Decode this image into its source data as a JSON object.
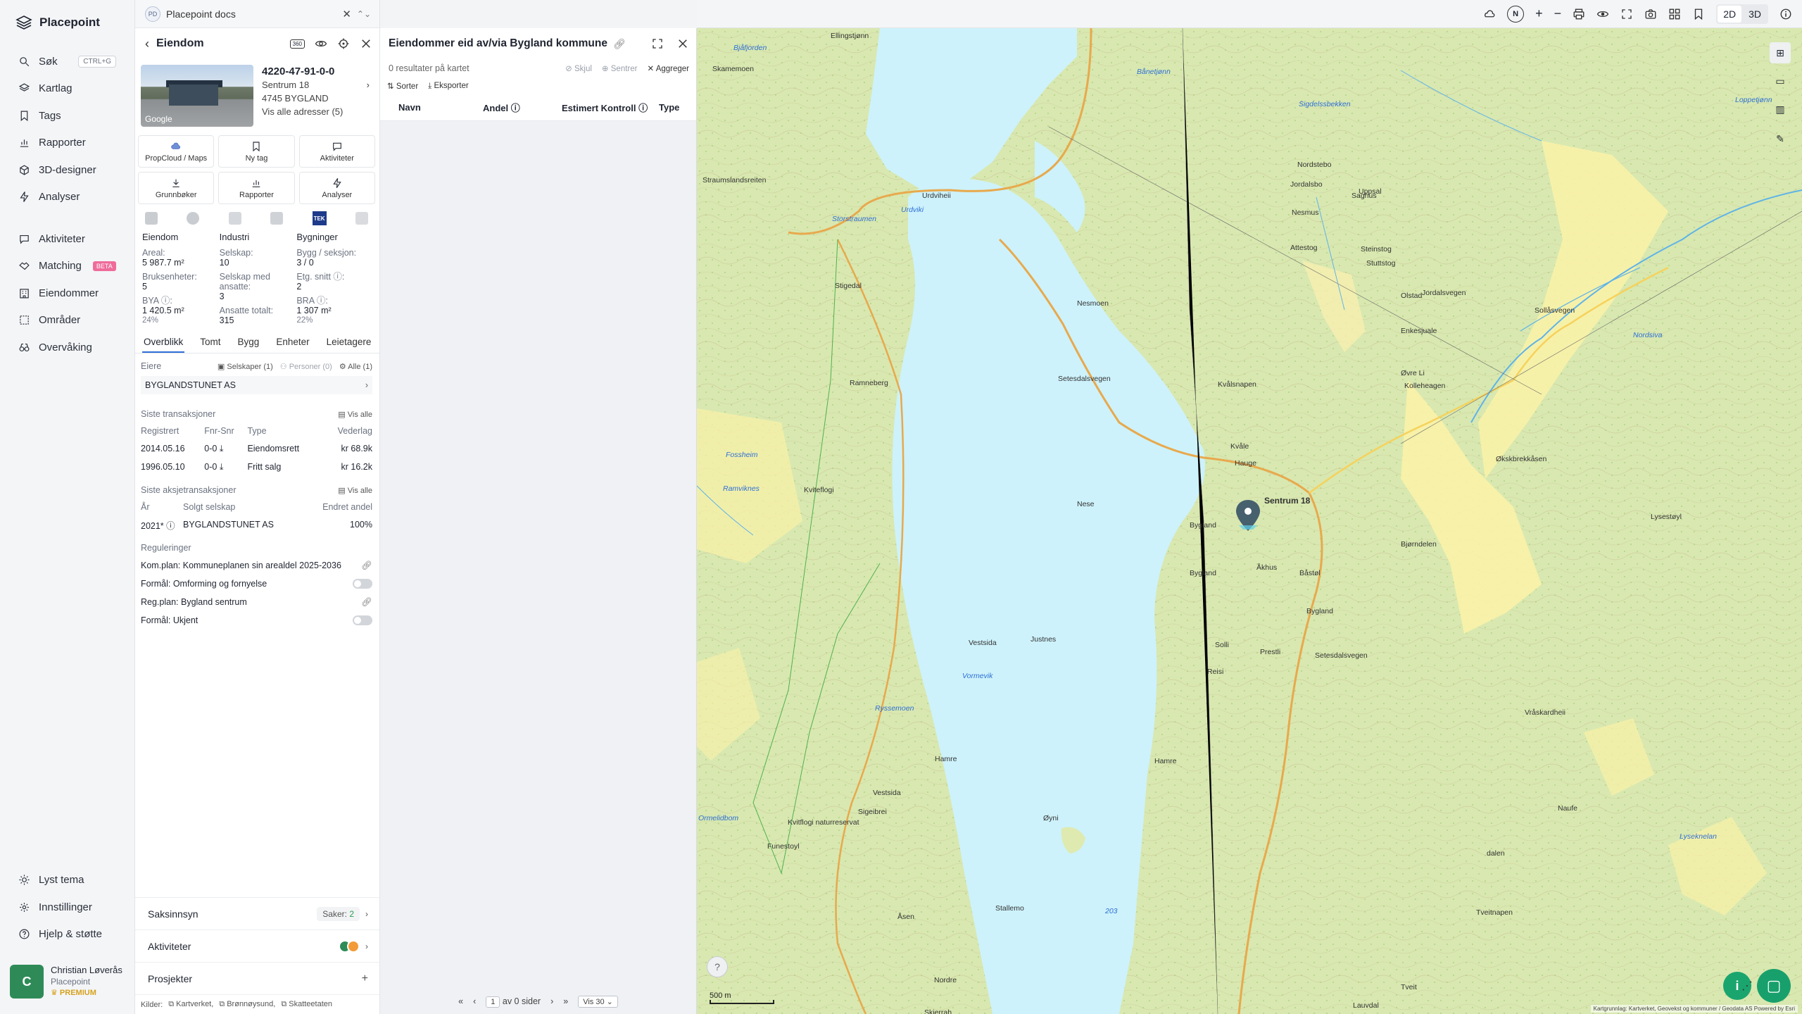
{
  "brand": {
    "name": "Placepoint"
  },
  "nav": {
    "items": [
      {
        "label": "Søk",
        "icon": "search-icon",
        "kbd": "CTRL+G"
      },
      {
        "label": "Kartlag",
        "icon": "layers-icon"
      },
      {
        "label": "Tags",
        "icon": "bookmark-icon"
      },
      {
        "label": "Rapporter",
        "icon": "chart-icon"
      },
      {
        "label": "3D-designer",
        "icon": "cube-icon"
      },
      {
        "label": "Analyser",
        "icon": "bolt-icon"
      }
    ],
    "items2": [
      {
        "label": "Aktiviteter",
        "icon": "chat-icon"
      },
      {
        "label": "Matching",
        "icon": "handshake-icon",
        "badge": "BETA"
      },
      {
        "label": "Eiendommer",
        "icon": "building-icon"
      },
      {
        "label": "Områder",
        "icon": "dashed-square-icon"
      },
      {
        "label": "Overvåking",
        "icon": "binoculars-icon"
      }
    ],
    "bottom": [
      {
        "label": "Lyst tema",
        "icon": "sun-icon"
      },
      {
        "label": "Innstillinger",
        "icon": "gear-icon"
      },
      {
        "label": "Hjelp & støtte",
        "icon": "help-icon"
      }
    ],
    "user": {
      "initial": "C",
      "name": "Christian Løverås",
      "org": "Placepoint",
      "plan": "PREMIUM"
    }
  },
  "docs": {
    "badge": "PD",
    "title": "Placepoint docs"
  },
  "property": {
    "header": "Eiendom",
    "header_badge": "360",
    "id": "4220-47-91-0-0",
    "address": "Sentrum 18",
    "postal": "4745 BYGLAND",
    "all_addresses": "Vis alle adresser (5)",
    "thumb_label": "Google",
    "actions": [
      {
        "label": "PropCloud / Maps",
        "icon": "cloud-icon"
      },
      {
        "label": "Ny tag",
        "icon": "bookmark-icon"
      },
      {
        "label": "Aktiviteter",
        "icon": "chat-icon"
      },
      {
        "label": "Grunnbøker",
        "icon": "download-icon"
      },
      {
        "label": "Rapporter",
        "icon": "chart-icon"
      },
      {
        "label": "Analyser",
        "icon": "bolt-icon"
      }
    ],
    "tek_badge": "TEK",
    "stats": {
      "col1": {
        "head": "Eiendom",
        "areal_k": "Areal:",
        "areal_v": "5 987.7 m²",
        "bruks_k": "Bruksenheter:",
        "bruks_v": "5",
        "bya_k": "BYA ⓘ:",
        "bya_v": "1 420.5 m²",
        "bya_p": "24%"
      },
      "col2": {
        "head": "Industri",
        "sel_k": "Selskap:",
        "sel_v": "10",
        "ans_k": "Selskap med ansatte:",
        "ans_v": "3",
        "tot_k": "Ansatte totalt:",
        "tot_v": "315"
      },
      "col3": {
        "head": "Bygninger",
        "bygg_k": "Bygg / seksjon:",
        "bygg_v": "3 / 0",
        "etg_k": "Etg. snitt ⓘ:",
        "etg_v": "2",
        "bra_k": "BRA ⓘ:",
        "bra_v": "1 307 m²",
        "bra_p": "22%"
      }
    },
    "tabs": [
      "Overblikk",
      "Tomt",
      "Bygg",
      "Enheter",
      "Leietagere"
    ],
    "owners": {
      "label": "Eiere",
      "filters": [
        "Selskaper (1)",
        "Personer (0)",
        "Alle (1)"
      ],
      "owner": "BYGLANDSTUNET AS"
    },
    "transactions": {
      "label": "Siste transaksjoner",
      "view_all": "Vis alle",
      "headers": [
        "Registrert",
        "Fnr-Snr",
        "Type",
        "Vederlag"
      ],
      "rows": [
        [
          "2014.05.16",
          "0-0 ⤓",
          "Eiendomsrett",
          "kr 68.9k"
        ],
        [
          "1996.05.10",
          "0-0 ⤓",
          "Fritt salg",
          "kr 16.2k"
        ]
      ]
    },
    "share_tx": {
      "label": "Siste aksjetransaksjoner",
      "view_all": "Vis alle",
      "headers": [
        "År",
        "Solgt selskap",
        "Endret andel"
      ],
      "rows": [
        [
          "2021* ⓘ",
          "BYGLANDSTUNET AS",
          "100%"
        ]
      ]
    },
    "regulations": {
      "label": "Reguleringer",
      "rows": [
        {
          "text": "Kom.plan: Kommuneplanen sin arealdel 2025-2036",
          "end": "link"
        },
        {
          "text": "Formål: Omforming og fornyelse",
          "end": "toggle"
        },
        {
          "text": "Reg.plan: Bygland sentrum",
          "end": "link"
        },
        {
          "text": "Formål: Ukjent",
          "end": "toggle"
        }
      ]
    },
    "bottom": {
      "saksinnsyn": "Saksinnsyn",
      "saker_label": "Saker:",
      "saker_count": "2",
      "aktiviteter": "Aktiviteter",
      "prosjekter": "Prosjekter",
      "sources_label": "Kilder:",
      "sources": [
        "Kartverket,",
        "Brønnøysund,",
        "Skatteetaten"
      ]
    }
  },
  "list": {
    "title": "Eiendommer eid av/via Bygland kommune",
    "results": "0 resultater på kartet",
    "actions": [
      "Skjul",
      "Sentrer",
      "Aggreger"
    ],
    "tools": [
      "Sorter",
      "Eksporter"
    ],
    "columns": [
      "Navn",
      "Andel ⓘ",
      "Estimert Kontroll ⓘ",
      "Type"
    ],
    "pager": {
      "page": "1",
      "of": "av 0 sider",
      "per": "Vis 30"
    }
  },
  "map": {
    "view_2d": "2D",
    "view_3d": "3D",
    "north": "N",
    "scale": "500 m",
    "attribution": "Kartgrunnlag: Kartverket, Geovekst og kommuner / Geodata AS Powered by Esri",
    "marker": "Sentrum 18",
    "labels": [
      {
        "t": "Bjåfjorden",
        "w": true
      },
      {
        "t": "Skamemoen"
      },
      {
        "t": "Ellingstjønn"
      },
      {
        "t": "Storstraumen",
        "w": true
      },
      {
        "t": "Urdviki",
        "w": true
      },
      {
        "t": "Urdviheii"
      },
      {
        "t": "Straumslandsreiten"
      },
      {
        "t": "Stigedal"
      },
      {
        "t": "Nesmoen"
      },
      {
        "t": "Ramneberg"
      },
      {
        "t": "Kvålsnapen"
      },
      {
        "t": "Kvåle"
      },
      {
        "t": "Hauge"
      },
      {
        "t": "Nese"
      },
      {
        "t": "Bygland"
      },
      {
        "t": "Bygland"
      },
      {
        "t": "Bygland"
      },
      {
        "t": "Åkhus"
      },
      {
        "t": "Båstøl"
      },
      {
        "t": "Solli"
      },
      {
        "t": "Reisi"
      },
      {
        "t": "Prestli"
      },
      {
        "t": "Justnes"
      },
      {
        "t": "Vormevik",
        "w": true
      },
      {
        "t": "Kviteflogi"
      },
      {
        "t": "Ryssemoen",
        "w": true
      },
      {
        "t": "Hamre"
      },
      {
        "t": "Hamre"
      },
      {
        "t": "Sigeibrei"
      },
      {
        "t": "Øyni"
      },
      {
        "t": "Kvitflogi naturreservat"
      },
      {
        "t": "Funestoyl"
      },
      {
        "t": "Ormelidbom",
        "w": true
      },
      {
        "t": "Stallemo"
      },
      {
        "t": "Åsen"
      },
      {
        "t": "Nordre"
      },
      {
        "t": "Skjerrah"
      },
      {
        "t": "Nordstebo"
      },
      {
        "t": "Jordalsbo"
      },
      {
        "t": "Nesmus"
      },
      {
        "t": "Uppsal"
      },
      {
        "t": "Saghus"
      },
      {
        "t": "Attestog"
      },
      {
        "t": "Steinstog"
      },
      {
        "t": "Stuttstog"
      },
      {
        "t": "Olstad"
      },
      {
        "t": "Enkesjuale"
      },
      {
        "t": "Øvre Li"
      },
      {
        "t": "Kolleheagen"
      },
      {
        "t": "Økskbrekkåsen"
      },
      {
        "t": "Bjørndelen"
      },
      {
        "t": "Lysestøyl"
      },
      {
        "t": "Vråskardheii"
      },
      {
        "t": "Naufe"
      },
      {
        "t": "dalen"
      },
      {
        "t": "Lyseknelan",
        "w": true
      },
      {
        "t": "Tveitnapen"
      },
      {
        "t": "Tveit"
      },
      {
        "t": "Lauvdal"
      },
      {
        "t": "Fossheim",
        "w": true
      },
      {
        "t": "Ramviknes",
        "w": true
      },
      {
        "t": "Vestsida"
      },
      {
        "t": "Setesdalsvegen"
      },
      {
        "t": "Jordalsvegen"
      },
      {
        "t": "Setesdalsvegen"
      },
      {
        "t": "Vestsida"
      },
      {
        "t": "Bånetjønn",
        "w": true
      },
      {
        "t": "Sigdelssbekken",
        "w": true
      },
      {
        "t": "Loppetjønn",
        "w": true
      },
      {
        "t": "Sollåsvegen"
      },
      {
        "t": "203",
        "w": true
      },
      {
        "t": "Nordsiva",
        "w": true
      }
    ]
  }
}
